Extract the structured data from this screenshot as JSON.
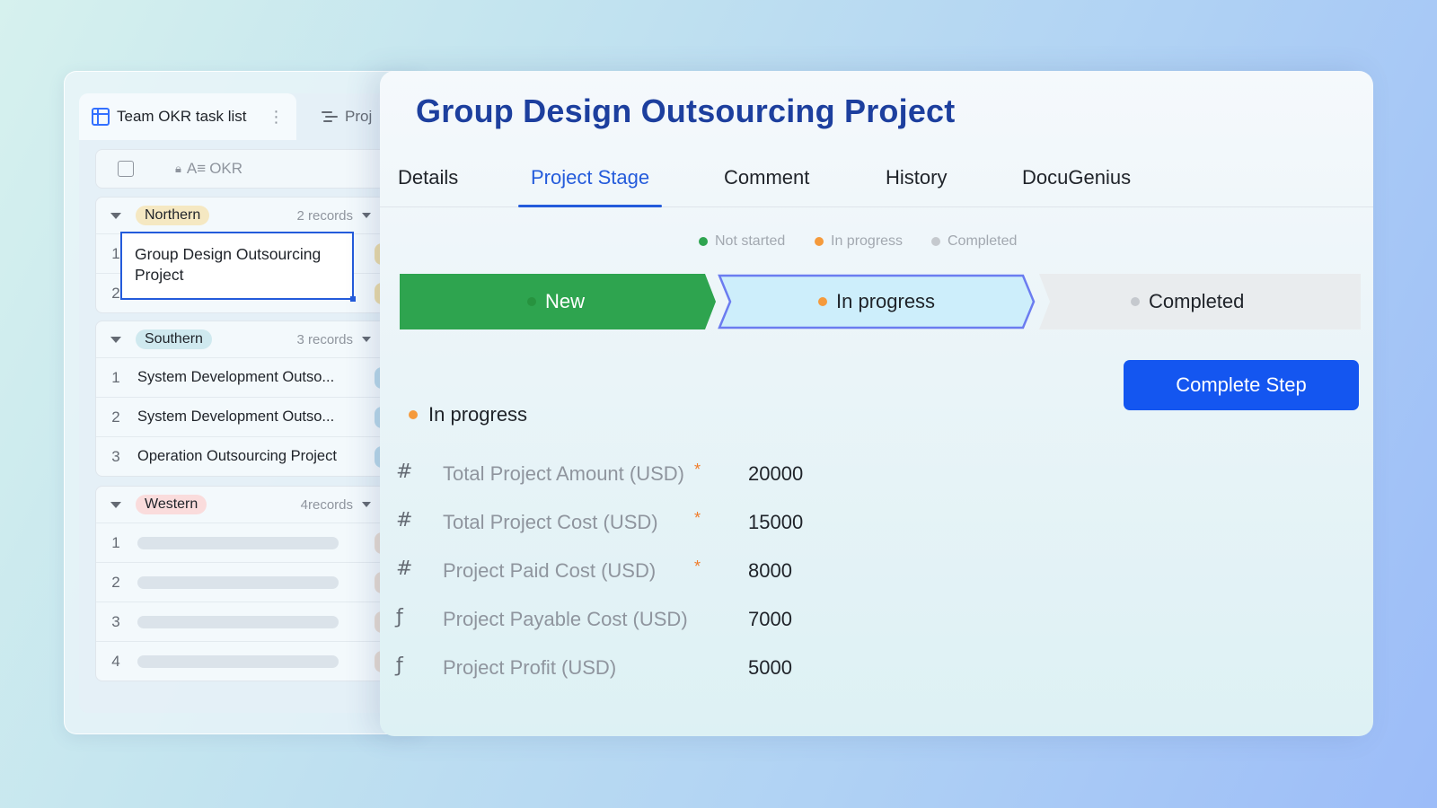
{
  "left_panel": {
    "tabs": [
      {
        "label": "Team OKR task list",
        "icon": "grid-table-icon"
      },
      {
        "label": "Proj",
        "icon": "gantt-icon"
      }
    ],
    "header": {
      "column": "OKR"
    },
    "groups": [
      {
        "name": "Northern",
        "count": "2 records",
        "pill_color": "#f5e8c2",
        "rows": [
          {
            "num": "1",
            "text": "Group Design Outsourcing Project"
          },
          {
            "num": "2",
            "text": ""
          }
        ]
      },
      {
        "name": "Southern",
        "count": "3 records",
        "pill_color": "#cfe9ef",
        "rows": [
          {
            "num": "1",
            "text": "System Development Outso..."
          },
          {
            "num": "2",
            "text": "System Development Outso..."
          },
          {
            "num": "3",
            "text": "Operation Outsourcing Project"
          }
        ]
      },
      {
        "name": "Western",
        "count": "4records",
        "pill_color": "#fadcdc",
        "rows": [
          {
            "num": "1",
            "text": ""
          },
          {
            "num": "2",
            "text": ""
          },
          {
            "num": "3",
            "text": ""
          },
          {
            "num": "4",
            "text": ""
          }
        ]
      }
    ]
  },
  "detail": {
    "title": "Group Design Outsourcing Project",
    "tabs": [
      "Details",
      "Project Stage",
      "Comment",
      "History",
      "DocuGenius"
    ],
    "active_tab": "Project Stage",
    "legend": [
      {
        "label": "Not started",
        "color": "#2ea44f"
      },
      {
        "label": "In progress",
        "color": "#f59a3c"
      },
      {
        "label": "Completed",
        "color": "#c5c9ce"
      }
    ],
    "stages": [
      {
        "label": "New",
        "state": "done",
        "color": "#2ea44f"
      },
      {
        "label": "In progress",
        "state": "current",
        "color": "#cdeefb"
      },
      {
        "label": "Completed",
        "state": "pending",
        "color": "#e9ecee"
      }
    ],
    "complete_button": "Complete Step",
    "current_status": "In progress",
    "fields": [
      {
        "icon": "#",
        "icon_name": "number-icon",
        "label": "Total Project Amount (USD)",
        "required": true,
        "value": "20000"
      },
      {
        "icon": "#",
        "icon_name": "number-icon",
        "label": "Total Project Cost (USD)",
        "required": true,
        "value": "15000"
      },
      {
        "icon": "#",
        "icon_name": "number-icon",
        "label": "Project Paid Cost (USD)",
        "required": true,
        "value": "8000"
      },
      {
        "icon": "ƒ",
        "icon_name": "formula-icon",
        "label": "Project Payable Cost (USD)",
        "required": false,
        "value": "7000"
      },
      {
        "icon": "ƒ",
        "icon_name": "formula-icon",
        "label": "Project Profit (USD)",
        "required": false,
        "value": "5000"
      }
    ],
    "required_mark": "*"
  }
}
